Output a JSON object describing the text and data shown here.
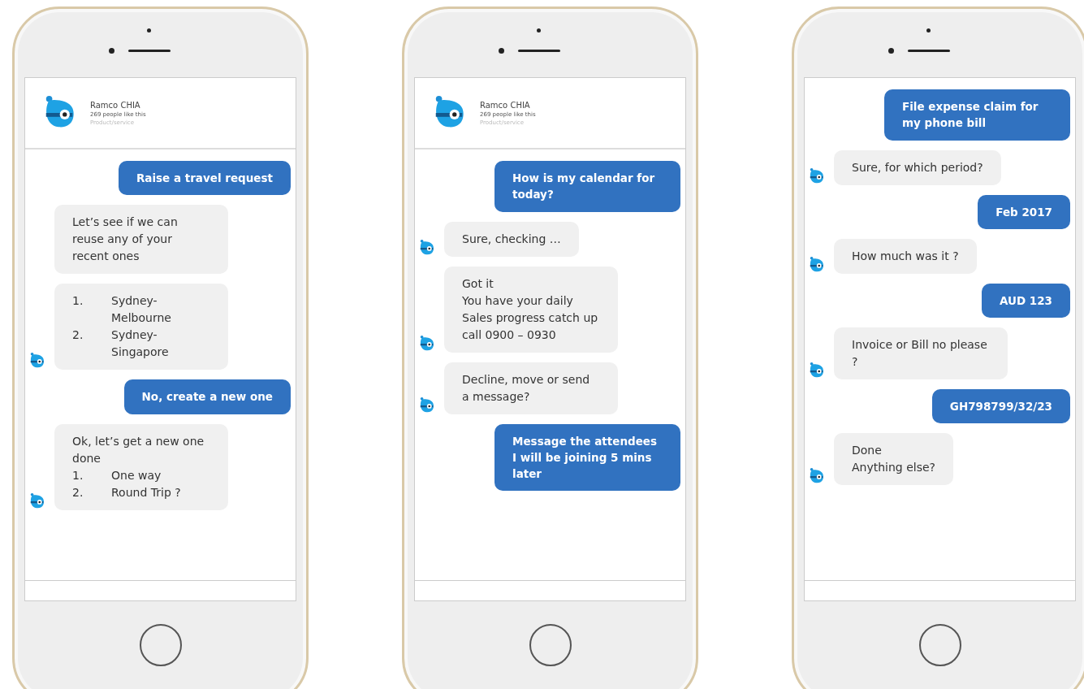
{
  "phones": [
    {
      "header": {
        "name": "Ramco CHIA",
        "likes": "269 people like this",
        "category": "Product/service"
      },
      "messages": [
        {
          "kind": "user",
          "lines": [
            "Raise a travel request"
          ]
        },
        {
          "kind": "bot",
          "avatar": false,
          "lines": [
            "Let’s see if we can reuse any of your recent ones"
          ]
        },
        {
          "kind": "bot",
          "avatar": true,
          "list": [
            {
              "num": "1.",
              "text": "Sydney-Melbourne"
            },
            {
              "num": "2.",
              "text": "Sydney-Singapore"
            }
          ]
        },
        {
          "kind": "user",
          "lines": [
            "No, create a new one"
          ]
        },
        {
          "kind": "bot",
          "avatar": true,
          "lines": [
            "Ok, let’s get a new one done"
          ],
          "list": [
            {
              "num": "1.",
              "text": "One way"
            },
            {
              "num": "2.",
              "text": "Round Trip ?"
            }
          ]
        }
      ]
    },
    {
      "header": {
        "name": "Ramco CHIA",
        "likes": "269 people like this",
        "category": "Product/service"
      },
      "messages": [
        {
          "kind": "user",
          "lines": [
            "How is my calendar for today?"
          ]
        },
        {
          "kind": "bot",
          "avatar": true,
          "lines": [
            "Sure, checking …"
          ]
        },
        {
          "kind": "bot",
          "avatar": true,
          "lines": [
            "Got it",
            "You have your daily Sales progress catch up call 0900 – 0930"
          ]
        },
        {
          "kind": "bot",
          "avatar": true,
          "lines": [
            "Decline, move or send a message?"
          ]
        },
        {
          "kind": "user",
          "lines": [
            "Message the attendees I will be joining 5 mins later"
          ]
        }
      ]
    },
    {
      "messages": [
        {
          "kind": "user",
          "lines": [
            "File expense claim for my phone bill"
          ]
        },
        {
          "kind": "bot",
          "avatar": true,
          "lines": [
            "Sure, for which period?"
          ]
        },
        {
          "kind": "user",
          "lines": [
            "Feb 2017"
          ]
        },
        {
          "kind": "bot",
          "avatar": true,
          "lines": [
            "How much was it ?"
          ]
        },
        {
          "kind": "user",
          "lines": [
            "AUD 123"
          ]
        },
        {
          "kind": "bot",
          "avatar": true,
          "lines": [
            "Invoice or Bill no please ?"
          ]
        },
        {
          "kind": "user",
          "lines": [
            "GH798799/32/23"
          ]
        },
        {
          "kind": "bot",
          "avatar": true,
          "lines": [
            "Done",
            "Anything else?"
          ]
        }
      ]
    }
  ]
}
